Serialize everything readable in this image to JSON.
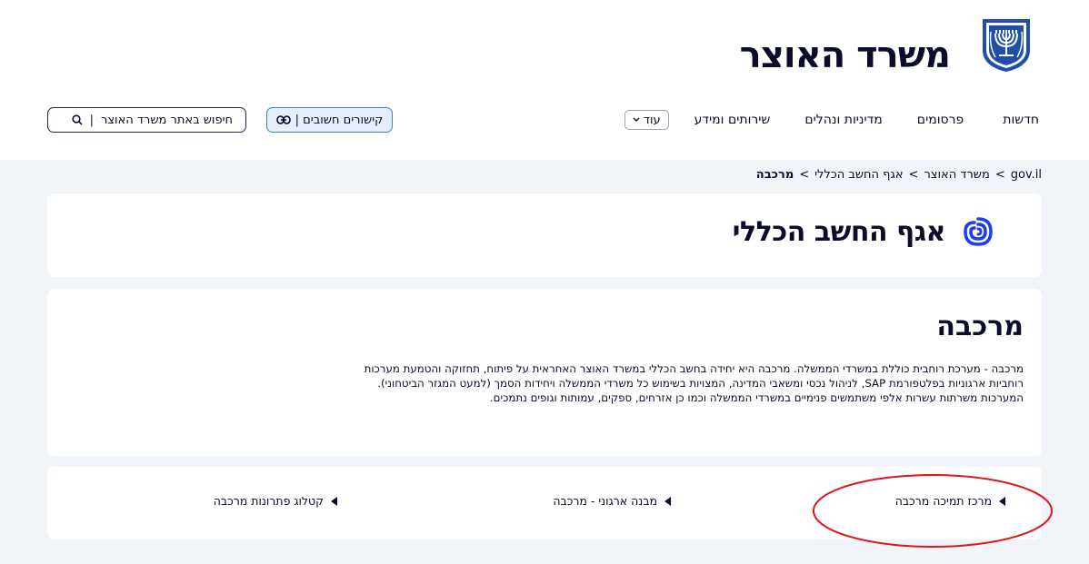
{
  "header": {
    "site_title": "משרד האוצר",
    "nav": [
      {
        "label": "חדשות"
      },
      {
        "label": "פרסומים"
      },
      {
        "label": "מדיניות ונהלים"
      },
      {
        "label": "שירותים ומידע"
      }
    ],
    "more_label": "עוד",
    "links_label": "קישורים חשובים |",
    "search_placeholder": "חיפוש באתר משרד האוצר",
    "search_sep": "|"
  },
  "breadcrumb": {
    "items": [
      "gov.il",
      "משרד האוצר",
      "אגף החשב הכללי"
    ],
    "current": "מרכבה",
    "sep": ">"
  },
  "department": {
    "title": "אגף החשב הכללי"
  },
  "merkava": {
    "title": "מרכבה",
    "description": "מרכבה - מערכת רוחבית כוללת במשרדי הממשלה. מרכבה היא יחידה בחשב הכללי במשרד האוצר האחראית על פיתוח, תחזוקה והטמעת מערכות רוחביות ארגוניות בפלטפורמת SAP, לניהול נכסי ומשאבי המדינה, המצויות בשימוש כל משרדי הממשלה ויחידות הסמך (למעט המגזר הביטחוני). המערכות משרתות עשרות אלפי משתמשים פנימיים במשרדי הממשלה וכמו כן אזרחים, ספקים, עמותות וגופים נתמכים."
  },
  "quick_links": [
    {
      "label": "מרכז תמיכה מרכבה"
    },
    {
      "label": "מבנה ארגוני - מרכבה"
    },
    {
      "label": "קטלוג פתרונות מרכבה"
    }
  ],
  "colors": {
    "annotation": "#e0141c",
    "accent_blue": "#3d7bd9",
    "dept_icon": "#1a3df0"
  }
}
